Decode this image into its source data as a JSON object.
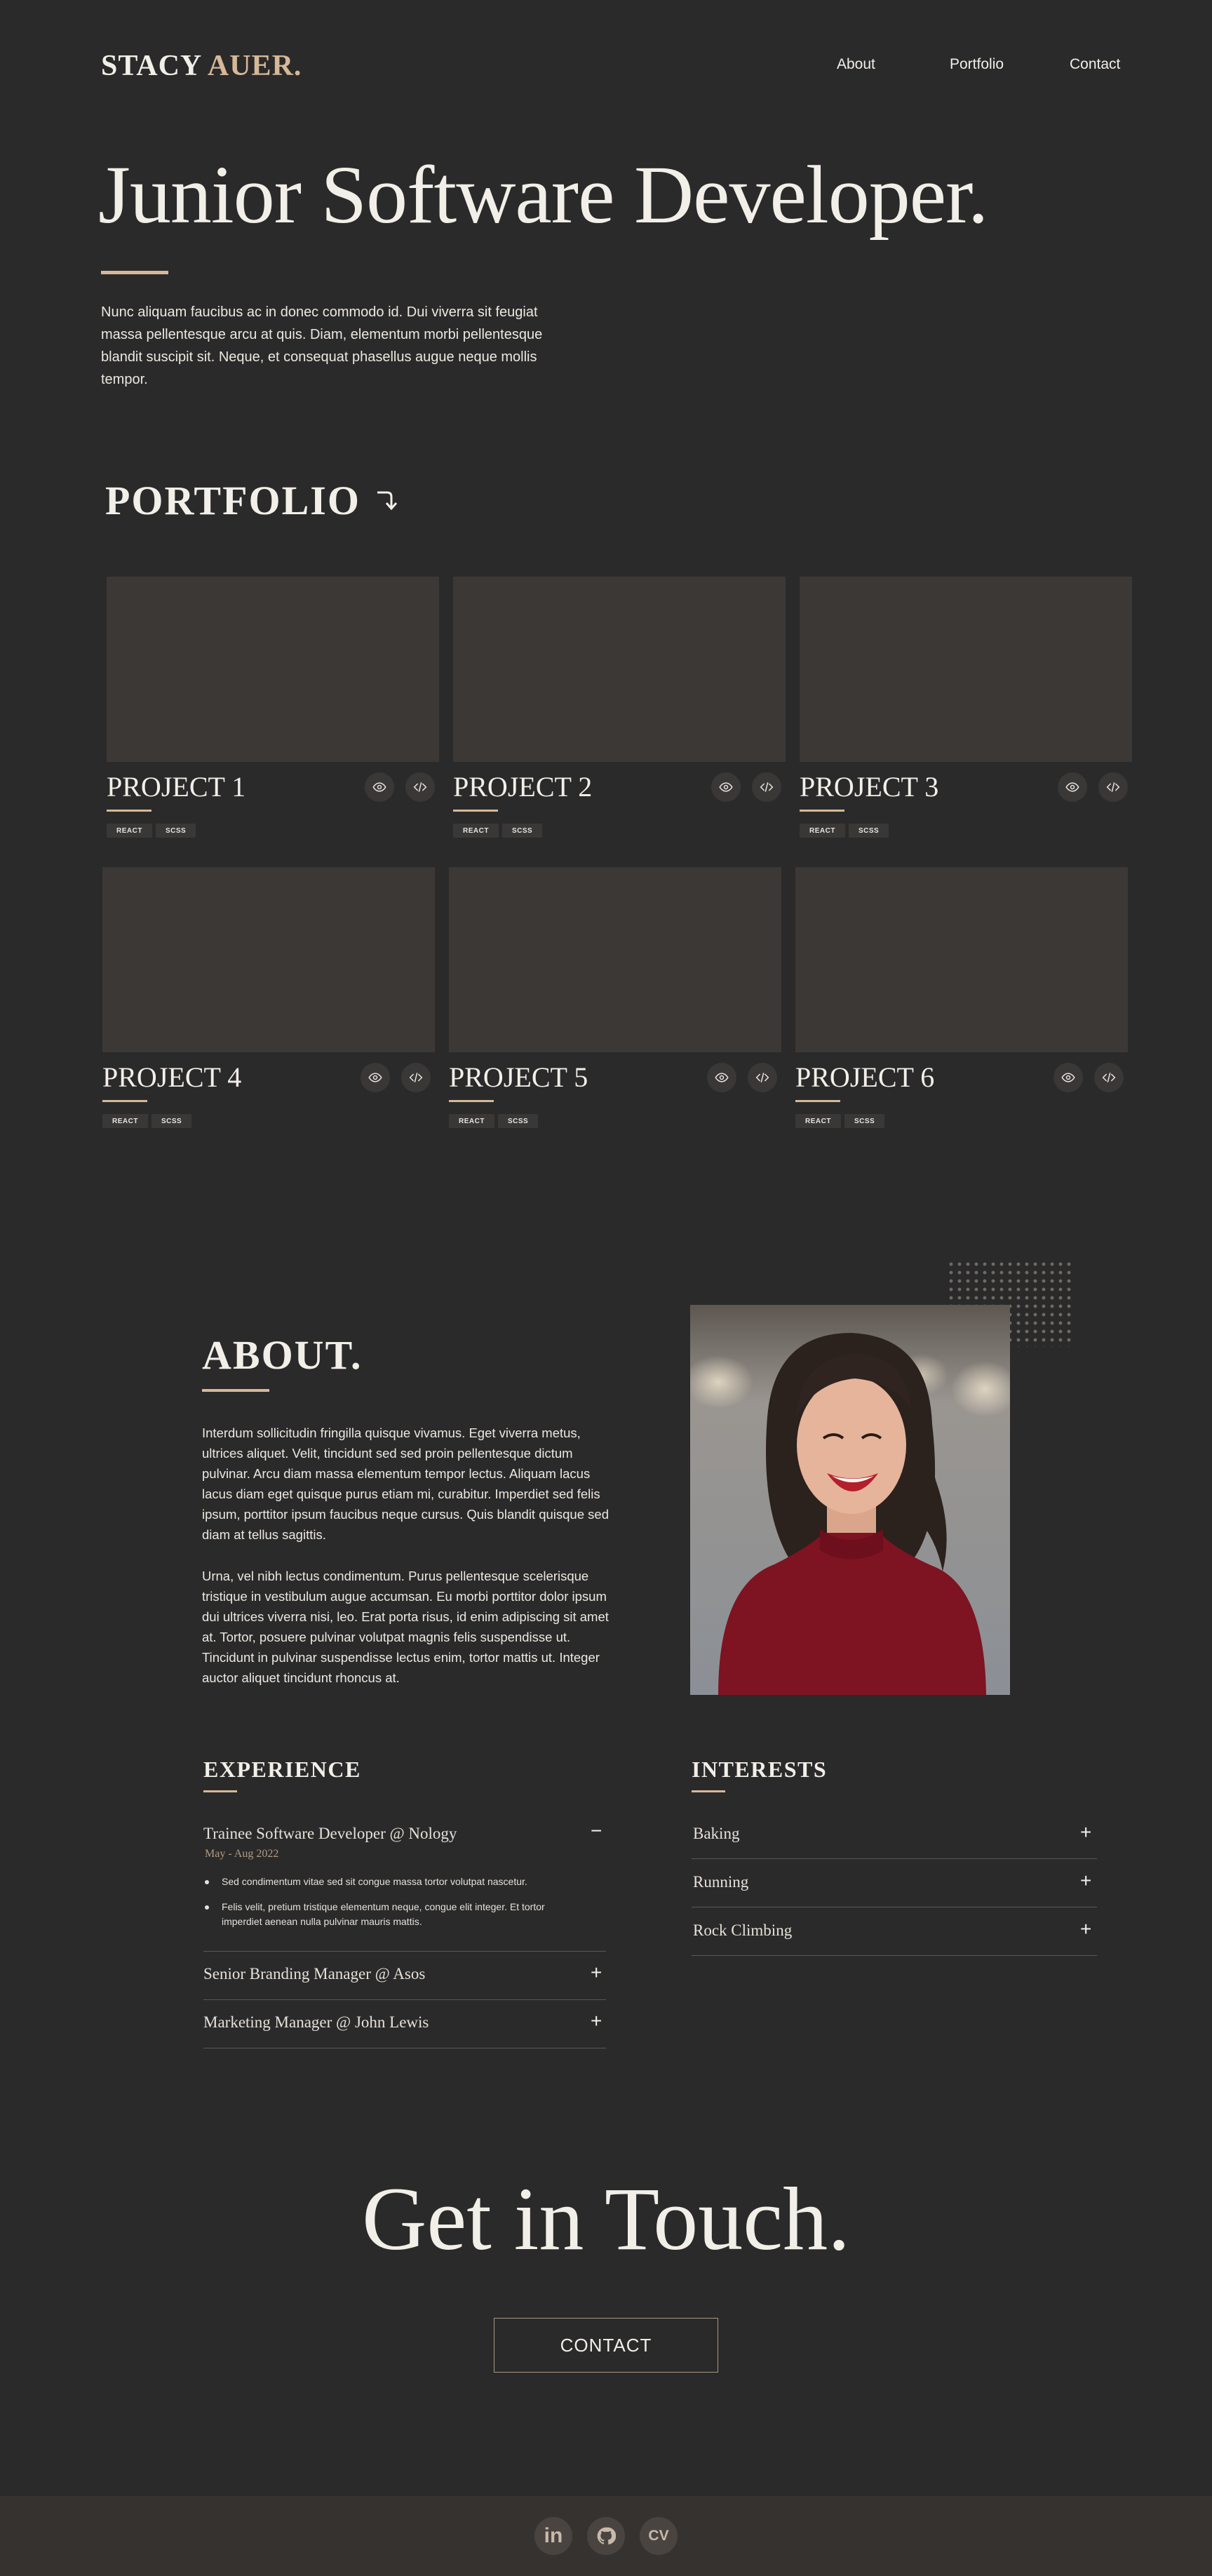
{
  "header": {
    "logo_first": "STACY",
    "logo_second": "AUER.",
    "nav": [
      "About",
      "Portfolio",
      "Contact"
    ]
  },
  "hero": {
    "title": "Junior Software Developer.",
    "text": "Nunc aliquam faucibus ac in donec commodo id. Dui viverra sit feugiat massa pellentesque arcu at quis. Diam, elementum morbi pellentesque blandit suscipit sit. Neque, et consequat phasellus augue neque mollis tempor."
  },
  "portfolio": {
    "heading": "PORTFOLIO",
    "projects": [
      {
        "title": "PROJECT 1",
        "tags": [
          "REACT",
          "SCSS"
        ]
      },
      {
        "title": "PROJECT 2",
        "tags": [
          "REACT",
          "SCSS"
        ]
      },
      {
        "title": "PROJECT 3",
        "tags": [
          "REACT",
          "SCSS"
        ]
      },
      {
        "title": "PROJECT 4",
        "tags": [
          "REACT",
          "SCSS"
        ]
      },
      {
        "title": "PROJECT 5",
        "tags": [
          "REACT",
          "SCSS"
        ]
      },
      {
        "title": "PROJECT 6",
        "tags": [
          "REACT",
          "SCSS"
        ]
      }
    ]
  },
  "about": {
    "heading": "ABOUT.",
    "para1": "Interdum sollicitudin fringilla quisque vivamus. Eget viverra metus, ultrices aliquet. Velit, tincidunt sed sed proin pellentesque dictum pulvinar. Arcu diam massa elementum tempor lectus. Aliquam lacus lacus diam eget quisque purus etiam mi, curabitur. Imperdiet sed felis ipsum, porttitor ipsum faucibus neque cursus. Quis blandit quisque sed diam at tellus sagittis.",
    "para2": "Urna, vel nibh lectus condimentum. Purus pellentesque scelerisque tristique in vestibulum augue accumsan. Eu morbi porttitor dolor ipsum dui ultrices viverra nisi, leo. Erat porta risus, id enim adipiscing sit amet at. Tortor, posuere pulvinar volutpat magnis felis suspendisse ut. Tincidunt in pulvinar suspendisse lectus enim, tortor mattis ut. Integer auctor aliquet tincidunt rhoncus at."
  },
  "experience": {
    "heading": "EXPERIENCE",
    "items": [
      {
        "label": "Trainee Software Developer @ Nology",
        "date": "May - Aug 2022",
        "sign": "−",
        "bullets": [
          "Sed condimentum vitae sed sit congue massa tortor volutpat nascetur.",
          "Felis velit, pretium tristique elementum neque, congue elit integer. Et tortor imperdiet aenean nulla pulvinar mauris mattis."
        ]
      },
      {
        "label": "Senior Branding Manager @ Asos",
        "sign": "+"
      },
      {
        "label": "Marketing Manager @ John Lewis",
        "sign": "+"
      }
    ]
  },
  "interests": {
    "heading": "INTERESTS",
    "items": [
      {
        "label": "Baking",
        "sign": "+"
      },
      {
        "label": "Running",
        "sign": "+"
      },
      {
        "label": "Rock Climbing",
        "sign": "+"
      }
    ]
  },
  "contact": {
    "title": "Get in Touch.",
    "button": "CONTACT"
  },
  "footer": {
    "social": [
      {
        "icon": "linkedin-icon",
        "label": "in"
      },
      {
        "icon": "github-icon",
        "label": ""
      },
      {
        "icon": "cv-icon",
        "label": "CV"
      }
    ]
  },
  "colors": {
    "background": "#2b2a2a",
    "accent": "#d6b899",
    "card": "#3b3836",
    "footer": "#363230"
  }
}
